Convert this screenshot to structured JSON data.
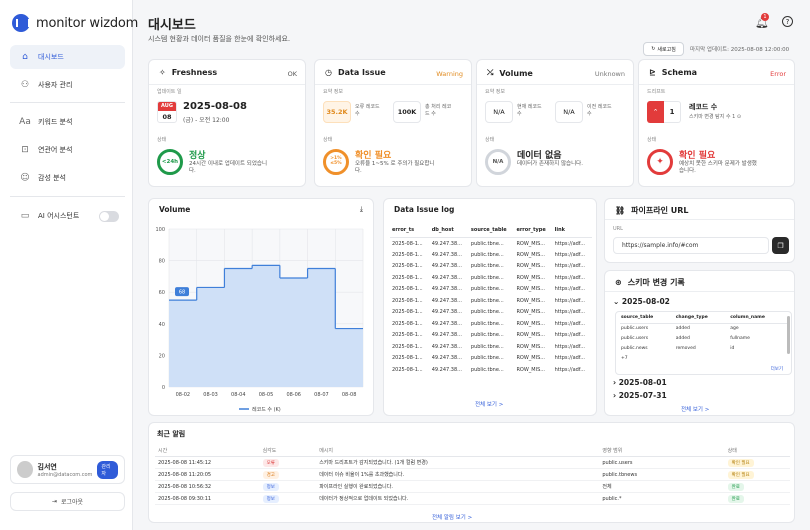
{
  "app": {
    "logo_text": "monitor wizdom"
  },
  "sidebar": {
    "items": [
      {
        "label": "대시보드",
        "icon": "home-icon",
        "active": true
      },
      {
        "label": "사용자 관리",
        "icon": "users-icon"
      },
      {
        "label": "키워드 분석",
        "icon": "keyword-icon"
      },
      {
        "label": "연관어 분석",
        "icon": "network-icon"
      },
      {
        "label": "감성 분석",
        "icon": "sentiment-icon"
      }
    ],
    "assistant_label": "AI 어시스턴트",
    "user": {
      "name": "김서연",
      "email": "admin@datacom.com",
      "role": "관리자"
    },
    "logout_label": "로그아웃"
  },
  "header": {
    "title": "대시보드",
    "subtitle": "시스템 현황과 데이터 품질을 한눈에 확인하세요.",
    "notification_count": "1",
    "refresh_label": "새로고침",
    "last_update": "마지막 업데이트: 2025-08-08 12:00:00"
  },
  "cards": {
    "freshness": {
      "title": "Freshness",
      "status": "OK",
      "update_label": "업데이트 일",
      "month": "AUG",
      "day": "08",
      "date": "2025-08-08",
      "time": "(금) - 오전 12:00",
      "state_label": "상태",
      "ring": "<24h",
      "state_title": "정상",
      "state_desc": "24시간 이내로 업데이트 되었습니다."
    },
    "data_issue": {
      "title": "Data Issue",
      "status": "Warning",
      "summary_label": "요약 정보",
      "error_value": "35.2K",
      "error_label": "오류 레코드 수",
      "total_value": "100K",
      "total_label": "총 처리 레코드 수",
      "state_label": "상태",
      "ring": ">1% ≤5%",
      "state_title": "확인 필요",
      "state_desc": "오류율 1~5% 로 주의가 필요합니다."
    },
    "volume": {
      "title": "Volume",
      "status": "Unknown",
      "summary_label": "요약 정보",
      "current_value": "N/A",
      "current_label": "현재 레코드 수",
      "prev_value": "N/A",
      "prev_label": "이전 레코드 수",
      "state_label": "상태",
      "ring": "N/A",
      "state_title": "데이터 없음",
      "state_desc": "데이터가 존재하지 않습니다."
    },
    "schema": {
      "title": "Schema",
      "status": "Error",
      "drift_label": "드리프트",
      "count": "1",
      "count_title": "레코드 수",
      "count_desc": "스키마 변경 탐지 수 1 ⊙",
      "state_label": "상태",
      "state_title": "확인 필요",
      "state_desc": "예상치 못한 스키마 문제가 발생했습니다."
    }
  },
  "volume_chart": {
    "title": "Volume",
    "legend": "레코드 수 (K)",
    "tooltip": "68"
  },
  "chart_data": {
    "type": "area",
    "categories": [
      "08-02",
      "08-03",
      "08-04",
      "08-05",
      "08-06",
      "08-07",
      "08-08"
    ],
    "series": [
      {
        "name": "레코드 수 (K)",
        "values": [
          55,
          63,
          75,
          77,
          69,
          75,
          37
        ]
      }
    ],
    "ylim": [
      0,
      100
    ],
    "yticks": [
      "100",
      "80",
      "60",
      "40",
      "20",
      "0"
    ],
    "grid": true,
    "legend_position": "bottom"
  },
  "issue_log": {
    "title": "Data Issue log",
    "columns": [
      "error_ts",
      "db_host",
      "source_table",
      "error_type",
      "link"
    ],
    "rows": [
      [
        "2025-08-1...",
        "49.247.38...",
        "public.tbne...",
        "ROW_MIS...",
        "https://adf..."
      ],
      [
        "2025-08-1...",
        "49.247.38...",
        "public.tbne...",
        "ROW_MIS...",
        "https://adf..."
      ],
      [
        "2025-08-1...",
        "49.247.38...",
        "public.tbne...",
        "ROW_MIS...",
        "https://adf..."
      ],
      [
        "2025-08-1...",
        "49.247.38...",
        "public.tbne...",
        "ROW_MIS...",
        "https://adf..."
      ],
      [
        "2025-08-1...",
        "49.247.38...",
        "public.tbne...",
        "ROW_MIS...",
        "https://adf..."
      ],
      [
        "2025-08-1...",
        "49.247.38...",
        "public.tbne...",
        "ROW_MIS...",
        "https://adf..."
      ],
      [
        "2025-08-1...",
        "49.247.38...",
        "public.tbne...",
        "ROW_MIS...",
        "https://adf..."
      ],
      [
        "2025-08-1...",
        "49.247.38...",
        "public.tbne...",
        "ROW_MIS...",
        "https://adf..."
      ],
      [
        "2025-08-1...",
        "49.247.38...",
        "public.tbne...",
        "ROW_MIS...",
        "https://adf..."
      ],
      [
        "2025-08-1...",
        "49.247.38...",
        "public.tbne...",
        "ROW_MIS...",
        "https://adf..."
      ],
      [
        "2025-08-1...",
        "49.247.38...",
        "public.tbne...",
        "ROW_MIS...",
        "https://adf..."
      ],
      [
        "2025-08-1...",
        "49.247.38...",
        "public.tbne...",
        "ROW_MIS...",
        "https://adf..."
      ]
    ],
    "more_label": "전체 보기 >"
  },
  "pipeline": {
    "title": "파이프라인 URL",
    "url_label": "URL",
    "url": "https://sample.info/#com"
  },
  "schema_history": {
    "title": "스키마 변경 기록",
    "groups": [
      "2025-08-02",
      "2025-08-01",
      "2025-07-31"
    ],
    "columns": [
      "source_table",
      "change_type",
      "column_name"
    ],
    "rows": [
      [
        "public.users",
        "added",
        "age"
      ],
      [
        "public.users",
        "added",
        "fullname"
      ],
      [
        "public.news",
        "removed",
        "id"
      ],
      [
        "+7",
        "",
        ""
      ]
    ],
    "detail_label": "더보기",
    "more_label": "전체 보기 >"
  },
  "alerts": {
    "title": "최근 알림",
    "columns": [
      "시간",
      "심각도",
      "메시지",
      "영향 범위",
      "상태"
    ],
    "rows": [
      {
        "time": "2025-08-08 11:45:12",
        "severity": "오류",
        "sev": "err",
        "message": "스키마 드리프트가 감지되었습니다. (1개 컬럼 변경)",
        "scope": "public.users",
        "status": "확인 필요",
        "st": "need"
      },
      {
        "time": "2025-08-08 11:20:05",
        "severity": "경고",
        "sev": "warn",
        "message": "데이터 이슈 비율이 1%를 초과했습니다.",
        "scope": "public.tbnews",
        "status": "확인 필요",
        "st": "need"
      },
      {
        "time": "2025-08-08 10:56:32",
        "severity": "정보",
        "sev": "info",
        "message": "파이프라인 실행이 완료되었습니다.",
        "scope": "전체",
        "status": "완료",
        "st": "done"
      },
      {
        "time": "2025-08-08 09:30:11",
        "severity": "정보",
        "sev": "info",
        "message": "데이터가 정상적으로 업데이트 되었습니다.",
        "scope": "public.*",
        "status": "완료",
        "st": "done"
      }
    ],
    "more_label": "전체 알림 보기 >"
  }
}
